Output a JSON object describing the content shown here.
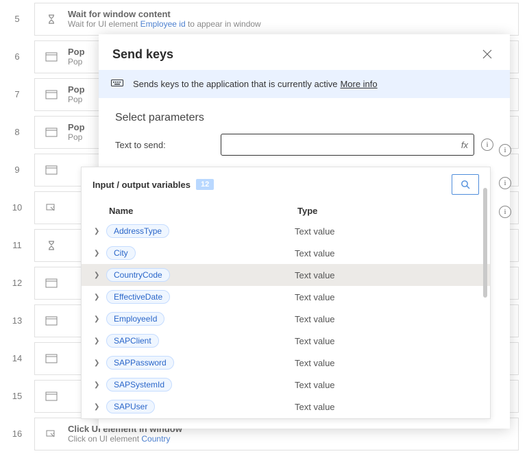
{
  "dialog": {
    "title": "Send keys",
    "infoText": "Sends keys to the application that is currently active",
    "moreInfo": "More info",
    "section": "Select parameters",
    "textToSend": "Text to send:",
    "fx": "fx"
  },
  "variables": {
    "header": "Input / output variables",
    "count": "12",
    "colName": "Name",
    "colType": "Type",
    "rows": [
      {
        "name": "AddressType",
        "type": "Text value"
      },
      {
        "name": "City",
        "type": "Text value"
      },
      {
        "name": "CountryCode",
        "type": "Text value"
      },
      {
        "name": "EffectiveDate",
        "type": "Text value"
      },
      {
        "name": "EmployeeId",
        "type": "Text value"
      },
      {
        "name": "SAPClient",
        "type": "Text value"
      },
      {
        "name": "SAPPassword",
        "type": "Text value"
      },
      {
        "name": "SAPSystemId",
        "type": "Text value"
      },
      {
        "name": "SAPUser",
        "type": "Text value"
      }
    ],
    "selectedIndex": 2
  },
  "steps": [
    {
      "num": "5",
      "icon": "hourglass",
      "title": "Wait for window content",
      "sub_before": "Wait for UI element ",
      "link": "Employee id",
      "sub_after": " to appear in window"
    },
    {
      "num": "6",
      "icon": "window",
      "title": "Pop",
      "sub_before": "Pop",
      "link": "",
      "sub_after": ""
    },
    {
      "num": "7",
      "icon": "window",
      "title": "Pop",
      "sub_before": "Pop",
      "link": "",
      "sub_after": ""
    },
    {
      "num": "8",
      "icon": "window",
      "title": "Pop",
      "sub_before": "Pop",
      "link": "",
      "sub_after": ""
    },
    {
      "num": "9",
      "icon": "window",
      "title": "",
      "sub_before": "",
      "link": "",
      "sub_after": ""
    },
    {
      "num": "10",
      "icon": "click",
      "title": "",
      "sub_before": "",
      "link": "",
      "sub_after": ""
    },
    {
      "num": "11",
      "icon": "hourglass",
      "title": "",
      "sub_before": "",
      "link": "",
      "sub_after": ""
    },
    {
      "num": "12",
      "icon": "window",
      "title": "",
      "sub_before": "",
      "link": "",
      "sub_after": ""
    },
    {
      "num": "13",
      "icon": "window",
      "title": "",
      "sub_before": "",
      "link": "",
      "sub_after": ""
    },
    {
      "num": "14",
      "icon": "window",
      "title": "",
      "sub_before": "",
      "link": "",
      "sub_after": ""
    },
    {
      "num": "15",
      "icon": "window",
      "title": "",
      "sub_before": "",
      "link": "",
      "sub_after": ""
    },
    {
      "num": "16",
      "icon": "click",
      "title": "Click UI element in window",
      "sub_before": "Click on UI element ",
      "link": "Country",
      "sub_after": ""
    }
  ]
}
